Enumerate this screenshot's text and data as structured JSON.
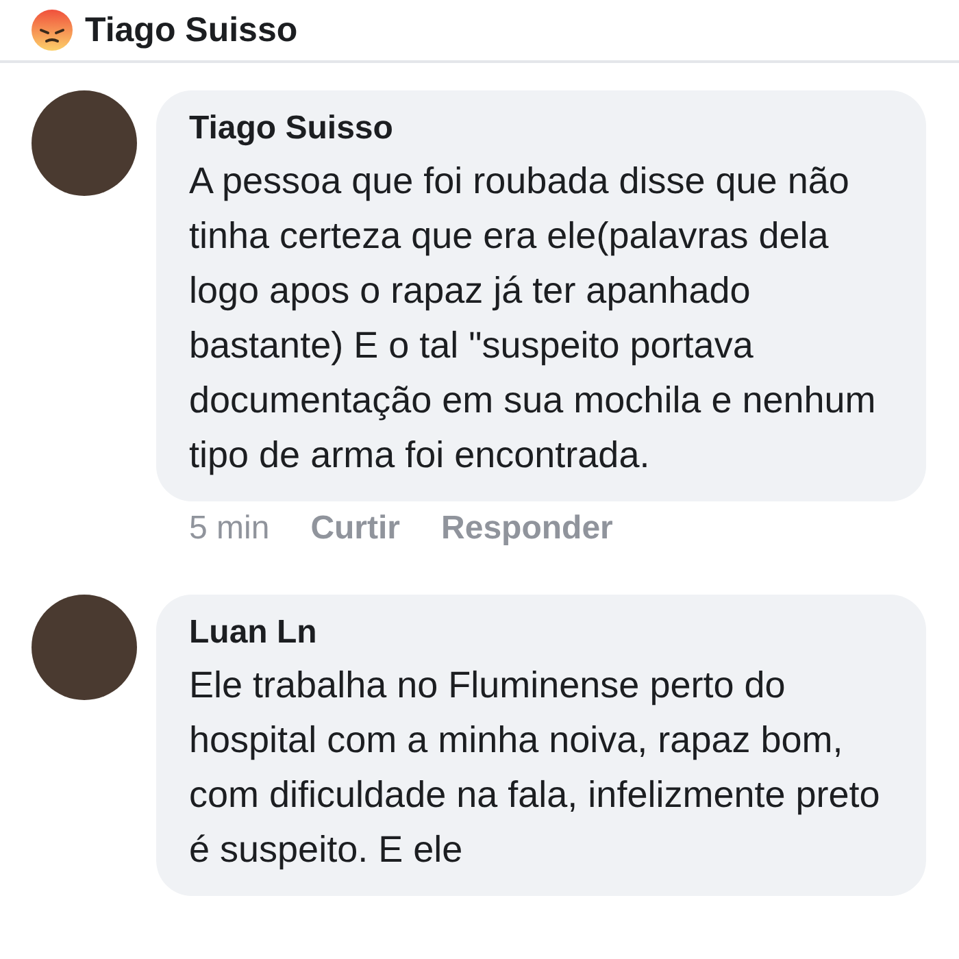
{
  "header": {
    "title": "Tiago Suisso"
  },
  "comments": [
    {
      "author": "Tiago Suisso",
      "text": "A pessoa que foi roubada disse que não tinha certeza que era ele(palavras dela logo apos o rapaz já ter apanhado bastante) E o tal \"suspeito portava documentação  em sua mochila e nenhum tipo de arma foi encontrada.",
      "time": "5 min",
      "actions": [
        "Curtir",
        "Responder"
      ]
    },
    {
      "author": "Luan Ln",
      "text": "Ele trabalha no Fluminense perto do hospital com a minha noiva, rapaz bom, com dificuldade na fala, infelizmente preto é suspeito. E ele"
    }
  ]
}
